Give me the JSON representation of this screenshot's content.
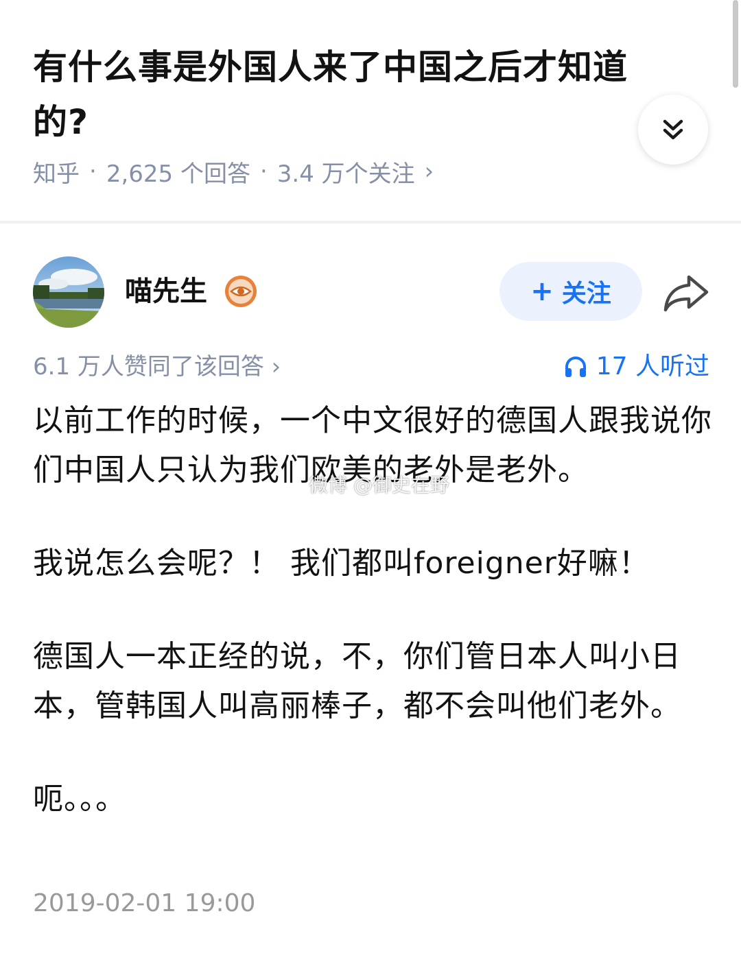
{
  "question": {
    "title": "有什么事是外国人来了中国之后才知道的?"
  },
  "meta": {
    "source": "知乎",
    "separator": "·",
    "answers": "2,625 个回答",
    "followers": "3.4 万个关注",
    "chevron": "›"
  },
  "author": {
    "name": "喵先生",
    "badge_icon": "eye-badge-icon"
  },
  "follow_button": {
    "plus": "+",
    "label": "关注"
  },
  "stats": {
    "votes": "6.1 万人赞同了该回答 ›",
    "listens": "17 人听过"
  },
  "answer": {
    "paragraphs": [
      "以前工作的时候，一个中文很好的德国人跟我说你们中国人只认为我们欧美的老外是老外。",
      "我说怎么会呢？！ 我们都叫foreigner好嘛！",
      "德国人一本正经的说，不，你们管日本人叫小日本，管韩国人叫高丽棒子，都不会叫他们老外。",
      "呃。。。"
    ],
    "timestamp": "2019-02-01 19:00"
  },
  "watermark": "微博 @御史在野",
  "colors": {
    "accent": "#1772f6",
    "follow_bg": "#ebf2fe",
    "meta_gray": "#8590a6",
    "badge_orange": "#e8813a"
  }
}
